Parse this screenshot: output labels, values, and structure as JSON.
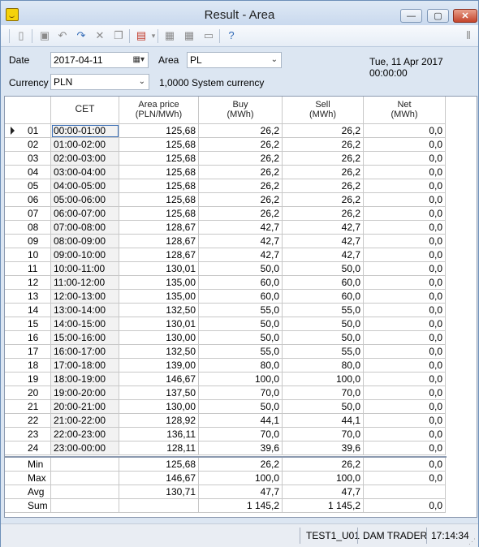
{
  "window": {
    "title": "Result - Area",
    "min_glyph": "—",
    "max_glyph": "▢",
    "close_glyph": "✕"
  },
  "toolbar": {
    "icons": [
      "new-icon",
      "save-icon",
      "undo-icon",
      "redo-icon",
      "delete-icon",
      "copy-icon",
      "pdf-export-icon",
      "import-icon",
      "export-icon",
      "print-icon",
      "help-icon",
      "columns-icon"
    ]
  },
  "params": {
    "date_label": "Date",
    "date_value": "2017-04-11",
    "area_label": "Area",
    "area_value": "PL",
    "timestamp": "Tue, 11 Apr 2017 00:00:00",
    "currency_label": "Currency",
    "currency_value": "PLN",
    "currency_note": "1,0000 System currency"
  },
  "grid": {
    "columns": [
      {
        "l1": "",
        "l2": ""
      },
      {
        "l1": "CET",
        "l2": ""
      },
      {
        "l1": "Area price",
        "l2": "(PLN/MWh)"
      },
      {
        "l1": "Buy",
        "l2": "(MWh)"
      },
      {
        "l1": "Sell",
        "l2": "(MWh)"
      },
      {
        "l1": "Net",
        "l2": "(MWh)"
      }
    ],
    "rows": [
      [
        "01",
        "00:00-01:00",
        "125,68",
        "26,2",
        "26,2",
        "0,0"
      ],
      [
        "02",
        "01:00-02:00",
        "125,68",
        "26,2",
        "26,2",
        "0,0"
      ],
      [
        "03",
        "02:00-03:00",
        "125,68",
        "26,2",
        "26,2",
        "0,0"
      ],
      [
        "04",
        "03:00-04:00",
        "125,68",
        "26,2",
        "26,2",
        "0,0"
      ],
      [
        "05",
        "04:00-05:00",
        "125,68",
        "26,2",
        "26,2",
        "0,0"
      ],
      [
        "06",
        "05:00-06:00",
        "125,68",
        "26,2",
        "26,2",
        "0,0"
      ],
      [
        "07",
        "06:00-07:00",
        "125,68",
        "26,2",
        "26,2",
        "0,0"
      ],
      [
        "08",
        "07:00-08:00",
        "128,67",
        "42,7",
        "42,7",
        "0,0"
      ],
      [
        "09",
        "08:00-09:00",
        "128,67",
        "42,7",
        "42,7",
        "0,0"
      ],
      [
        "10",
        "09:00-10:00",
        "128,67",
        "42,7",
        "42,7",
        "0,0"
      ],
      [
        "11",
        "10:00-11:00",
        "130,01",
        "50,0",
        "50,0",
        "0,0"
      ],
      [
        "12",
        "11:00-12:00",
        "135,00",
        "60,0",
        "60,0",
        "0,0"
      ],
      [
        "13",
        "12:00-13:00",
        "135,00",
        "60,0",
        "60,0",
        "0,0"
      ],
      [
        "14",
        "13:00-14:00",
        "132,50",
        "55,0",
        "55,0",
        "0,0"
      ],
      [
        "15",
        "14:00-15:00",
        "130,01",
        "50,0",
        "50,0",
        "0,0"
      ],
      [
        "16",
        "15:00-16:00",
        "130,00",
        "50,0",
        "50,0",
        "0,0"
      ],
      [
        "17",
        "16:00-17:00",
        "132,50",
        "55,0",
        "55,0",
        "0,0"
      ],
      [
        "18",
        "17:00-18:00",
        "139,00",
        "80,0",
        "80,0",
        "0,0"
      ],
      [
        "19",
        "18:00-19:00",
        "146,67",
        "100,0",
        "100,0",
        "0,0"
      ],
      [
        "20",
        "19:00-20:00",
        "137,50",
        "70,0",
        "70,0",
        "0,0"
      ],
      [
        "21",
        "20:00-21:00",
        "130,00",
        "50,0",
        "50,0",
        "0,0"
      ],
      [
        "22",
        "21:00-22:00",
        "128,92",
        "44,1",
        "44,1",
        "0,0"
      ],
      [
        "23",
        "22:00-23:00",
        "136,11",
        "70,0",
        "70,0",
        "0,0"
      ],
      [
        "24",
        "23:00-00:00",
        "128,11",
        "39,6",
        "39,6",
        "0,0"
      ]
    ],
    "summary": [
      [
        "Min",
        "",
        "125,68",
        "26,2",
        "26,2",
        "0,0"
      ],
      [
        "Max",
        "",
        "146,67",
        "100,0",
        "100,0",
        "0,0"
      ],
      [
        "Avg",
        "",
        "130,71",
        "47,7",
        "47,7",
        ""
      ],
      [
        "Sum",
        "",
        "",
        "1 145,2",
        "1 145,2",
        "0,0"
      ]
    ]
  },
  "status": {
    "user": "TEST1_U01",
    "role": "DAM TRADER",
    "time": "17:14:34"
  }
}
